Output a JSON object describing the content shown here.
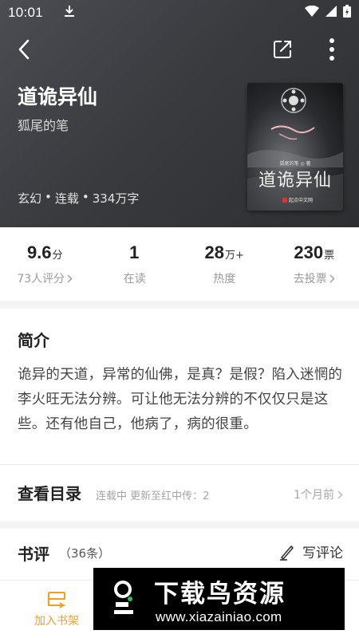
{
  "status_bar": {
    "time": "10:01"
  },
  "book": {
    "title": "道诡异仙",
    "author": "狐尾的笔",
    "meta": [
      "玄幻",
      "连载",
      "334万字"
    ],
    "cover": {
      "title": "道诡异仙",
      "author": "狐尾的笔 ◎ 著",
      "publisher": "起点中文网"
    }
  },
  "stats": [
    {
      "value": "9.6",
      "unit": "分",
      "label": "73人评分",
      "chevron": true
    },
    {
      "value": "1",
      "unit": "",
      "label": "在读",
      "chevron": false
    },
    {
      "value": "28",
      "unit": "万+",
      "label": "热度",
      "chevron": false
    },
    {
      "value": "230",
      "unit": "票",
      "label": "去投票",
      "chevron": true
    }
  ],
  "intro": {
    "title": "简介",
    "text": "诡异的天道，异常的仙佛，是真？是假？陷入迷惘的李火旺无法分辨。可让他无法分辨的不仅仅只是这些。还有他自己，他病了，病的很重。"
  },
  "toc": {
    "title": "查看目录",
    "status": "连载中 更新至红中传：2",
    "updated": "1个月前"
  },
  "reviews": {
    "title": "书评",
    "count": "（36条）",
    "write_label": "写评论"
  },
  "bottom": {
    "add_shelf": "加入书架"
  },
  "watermark": {
    "main": "下载鸟资源",
    "url": "www.xiazainiao.com"
  },
  "colors": {
    "accent": "#f0a020",
    "header_bg": "#3a3b3f"
  }
}
